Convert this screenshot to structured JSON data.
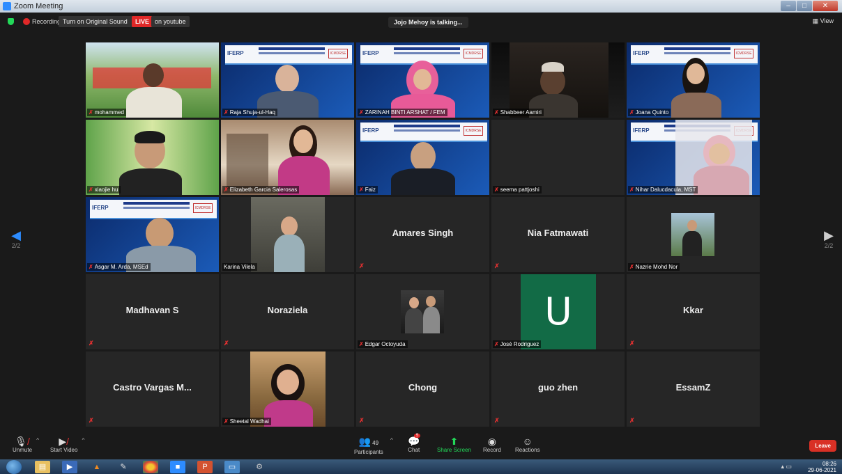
{
  "window": {
    "title": "Zoom Meeting",
    "min_label": "–",
    "max_label": "□",
    "close_label": "✕"
  },
  "topbar": {
    "recording_label": "Recording",
    "original_sound_label": "Turn on Original Sound",
    "live_badge": "LIVE",
    "live_destination": "on youtube",
    "talking": "Jojo Mehoy is talking...",
    "view_label": "View"
  },
  "paging": {
    "left_page": "2/2",
    "right_page": "2/2"
  },
  "participants": [
    {
      "name": "mohammed"
    },
    {
      "name": "Raja Shuja-ul-Haq"
    },
    {
      "name": "ZARINAH BINTI ARSHAT / FEM"
    },
    {
      "name": "Shabbeer Aamiri"
    },
    {
      "name": "Joana Quinto"
    },
    {
      "name": "xiaojie hu"
    },
    {
      "name": "Elizabeth Garcia Salerosas"
    },
    {
      "name": "Faiz"
    },
    {
      "name": "seema pattjoshi"
    },
    {
      "name": "Nihar Dalucdacula, MST"
    },
    {
      "name": "Asgar M. Arda, MSEd"
    },
    {
      "name": "Karina Vilela"
    },
    {
      "name": "Amares Singh"
    },
    {
      "name": "Nia Fatmawati"
    },
    {
      "name": "Nazrie Mohd Nor"
    },
    {
      "name": "Madhavan S"
    },
    {
      "name": "Noraziela"
    },
    {
      "name": "Edgar Octoyuda"
    },
    {
      "name": "José Rodriguez",
      "avatar_letter": "U"
    },
    {
      "name": "Kkar"
    },
    {
      "name": "Castro Vargas M..."
    },
    {
      "name": "Sheetal Wadhai"
    },
    {
      "name": "Chong"
    },
    {
      "name": "guo zhen"
    },
    {
      "name": "EssamZ"
    }
  ],
  "banner": {
    "logo": "IFERP",
    "badge": "ICMDRSE"
  },
  "toolbar": {
    "unmute": "Unmute",
    "start_video": "Start Video",
    "participants": "Participants",
    "participant_count": "49",
    "chat": "Chat",
    "chat_badge": "5",
    "share_screen": "Share Screen",
    "record": "Record",
    "reactions": "Reactions",
    "leave": "Leave"
  },
  "taskbar": {
    "time": "08:26",
    "date": "29-06-2021"
  },
  "colors": {
    "accent": "#2d8cff",
    "live": "#e02828",
    "share": "#23d959",
    "leave": "#d93025",
    "avatar_green": "#126b46"
  }
}
